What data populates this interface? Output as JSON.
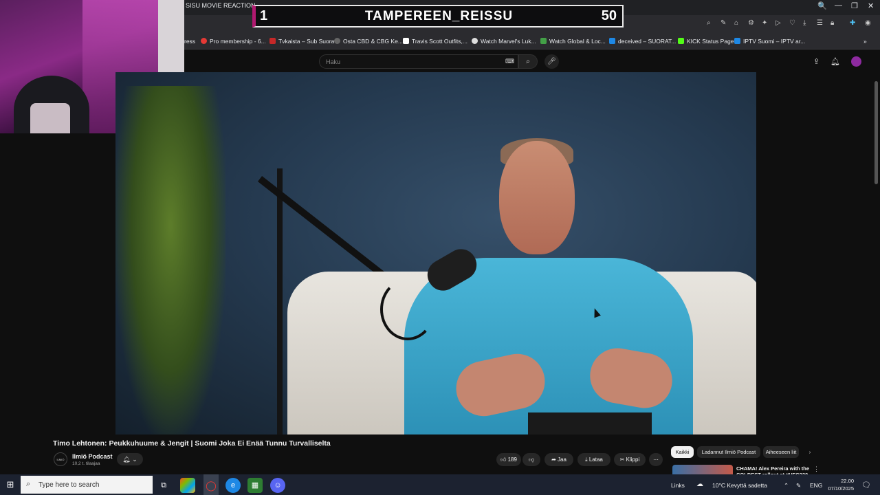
{
  "browser": {
    "tab_title": "SISU MOVIE REACTION –",
    "window_controls": [
      "🔍",
      "—",
      "❐",
      "✕"
    ],
    "bookmarks": [
      {
        "label": "ress",
        "color": "#444"
      },
      {
        "label": "Pro membership - 6...",
        "color": "#e53935"
      },
      {
        "label": "Tvkaista – Sub Suora",
        "color": "#c62828"
      },
      {
        "label": "Osta CBD & CBG Ke...",
        "color": "#666"
      },
      {
        "label": "Travis Scott Outfits,...",
        "color": "#ffffff"
      },
      {
        "label": "Watch Marvel's Luk...",
        "color": "#dddddd"
      },
      {
        "label": "Watch Global & Loc...",
        "color": "#43a047"
      },
      {
        "label": "deceived – SUORAT...",
        "color": "#1e88e5"
      },
      {
        "label": "KICK Status Page",
        "color": "#53fc18"
      },
      {
        "label": "IPTV Suomi – IPTV ar...",
        "color": "#1e88e5"
      }
    ]
  },
  "overlay": {
    "left_number": "1",
    "title": "TAMPEREEN_REISSU",
    "right_number": "50"
  },
  "youtube": {
    "search_placeholder": "Haku",
    "video_title": "Timo Lehtonen: Peukkuhuume & Jengit | Suomi Joka Ei Enää Tunnu Turvalliselta",
    "channel": {
      "avatar_text": "ILMIÖ",
      "name": "Ilmiö Podcast",
      "subscribers": "10,2 t. tilaajaa"
    },
    "actions": {
      "likes": "189",
      "share": "Jaa",
      "download": "Lataa",
      "clip": "Klippi",
      "more": "···"
    },
    "chips": [
      "Kaikki",
      "Ladannut Ilmiö Podcast",
      "Aiheeseen liit"
    ],
    "recommendation": {
      "title": "CHAMA! Alex Pereira with the COLDEST rollout at #UFC320"
    }
  },
  "taskbar": {
    "search_placeholder": "Type here to search",
    "tray": {
      "links": "Links",
      "weather": "10°C  Kevyttä sadetta",
      "lang": "ENG",
      "time": "22.00",
      "date": "07/10/2025"
    }
  }
}
